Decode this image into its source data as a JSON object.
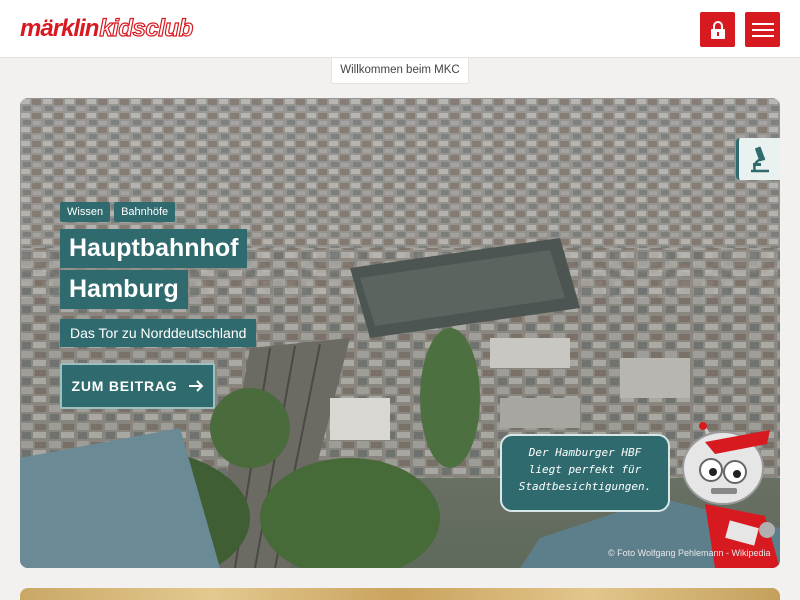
{
  "header": {
    "logo_brand": "märklin",
    "logo_club": "kidsclub",
    "lock_icon": "lock-icon",
    "menu_icon": "hamburger-menu-icon",
    "accent": "#d71920"
  },
  "welcome_tab": "Willkommen beim MKC",
  "hero": {
    "tags": [
      "Wissen",
      "Bahnhöfe"
    ],
    "title_lines": [
      "Hauptbahnhof",
      "Hamburg"
    ],
    "subtitle": "Das Tor zu Norddeutschland",
    "cta_label": "ZUM BEITRAG",
    "cta_icon": "arrow-right-icon",
    "category_icon": "microscope-icon",
    "speech_lines": [
      "Der Hamburger HBF",
      "liegt perfekt für",
      "Stadtbesichtigungen."
    ],
    "credit": "© Foto Wolfgang Pehlemann - Wikipedia",
    "theme": "#2f6b6e"
  }
}
